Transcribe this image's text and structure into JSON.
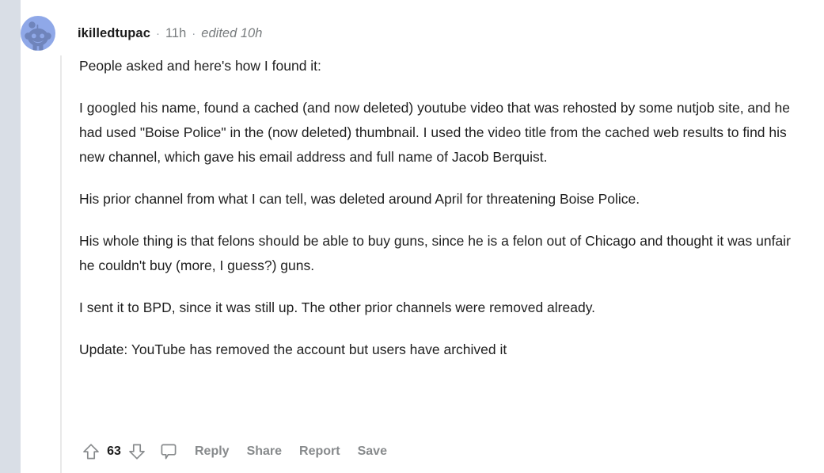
{
  "layout": {
    "gutter_color": "#d9dee6",
    "background_color": "#ffffff",
    "thread_line_color": "#e8e8e8",
    "avatar_bg_color": "#8fa8e8",
    "avatar_figure_color": "#6f84bb"
  },
  "comment": {
    "avatar_icon": "reddit-snoo-avatar",
    "author": "ikilledtupac",
    "separator": "·",
    "timestamp": "11h",
    "edited": "edited 10h",
    "paragraphs": [
      "People asked and here's how I found it:",
      "I googled his name, found a cached (and now deleted) youtube video that was rehosted by some nutjob site, and he had used \"Boise Police\" in the (now deleted) thumbnail. I used the video title from the cached web results to find his new channel, which gave his email address and full name of Jacob Berquist.",
      "His prior channel from what I can tell, was deleted around April for threatening Boise Police.",
      "His whole thing is that felons should be able to buy guns, since he is a felon out of Chicago and thought it was unfair he couldn't buy (more, I guess?) guns.",
      "I sent it to BPD, since it was still up. The other prior channels were removed already.",
      "Update: YouTube has removed the account but users have archived it"
    ]
  },
  "actions": {
    "upvote_icon": "upvote-arrow-icon",
    "vote_count": "63",
    "downvote_icon": "downvote-arrow-icon",
    "comment_icon": "comment-bubble-icon",
    "reply_label": "Reply",
    "share_label": "Share",
    "report_label": "Report",
    "save_label": "Save"
  }
}
